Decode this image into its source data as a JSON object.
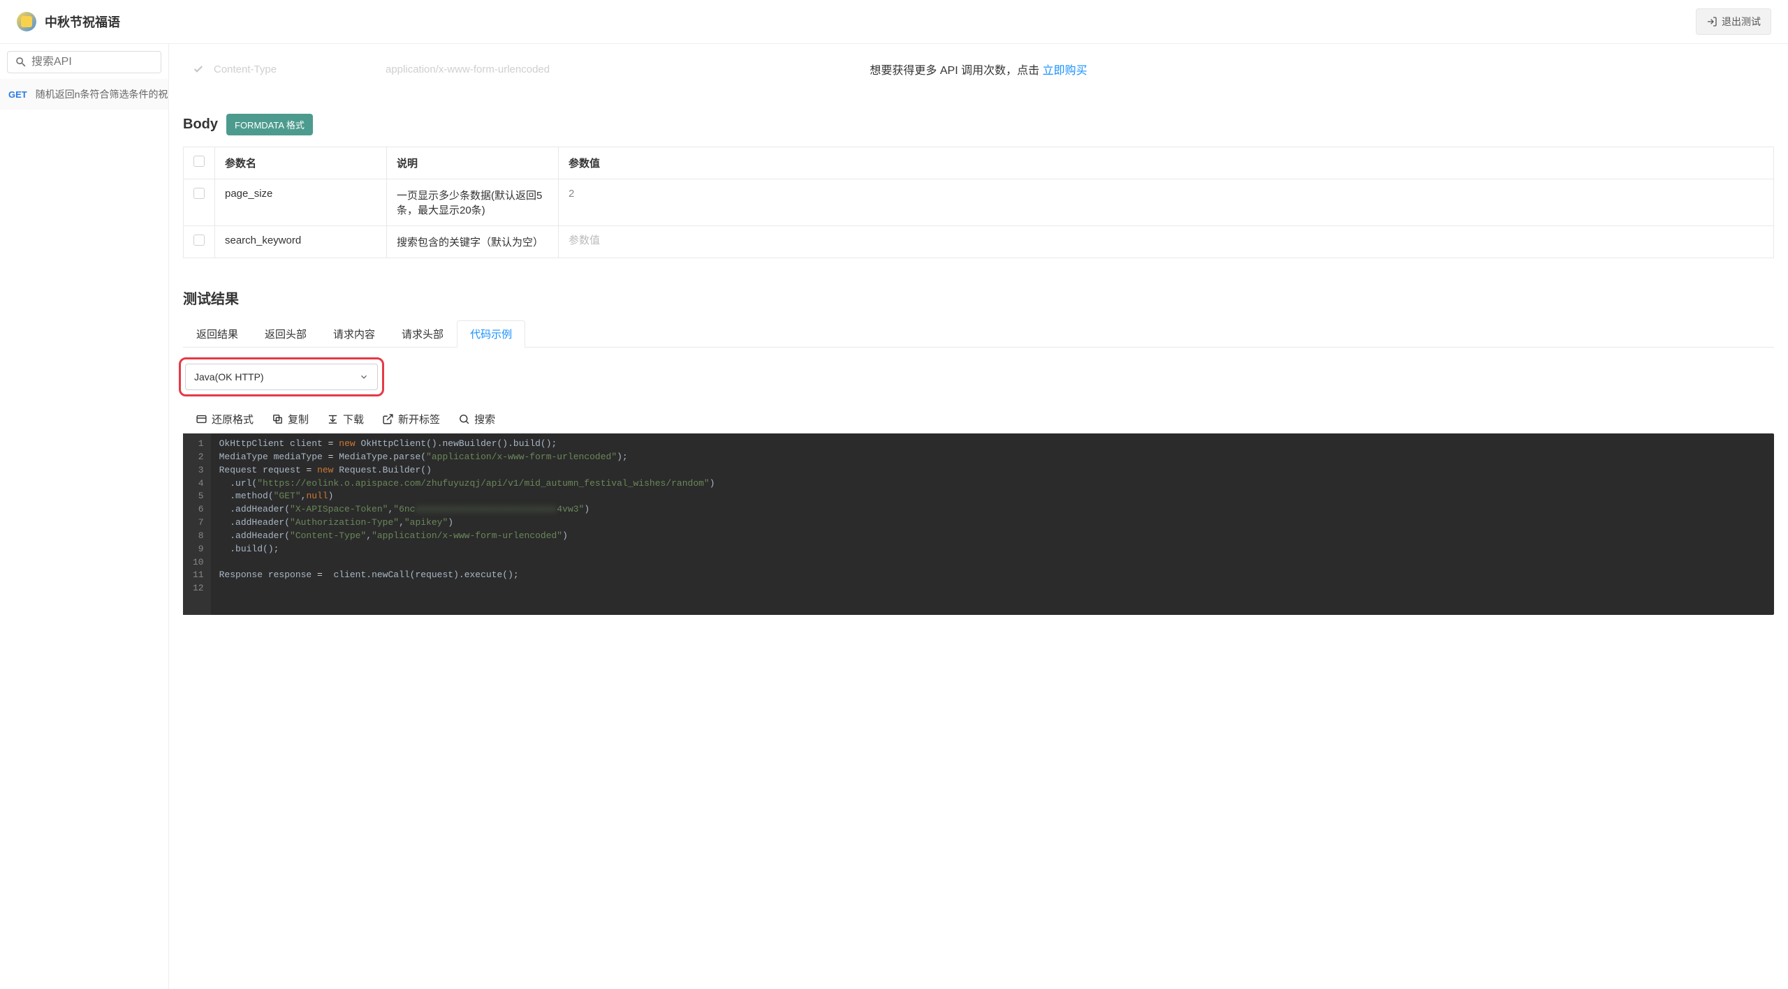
{
  "header": {
    "title": "中秋节祝福语",
    "exit_label": "退出测试"
  },
  "sidebar": {
    "search_placeholder": "搜索API",
    "items": [
      {
        "method": "GET",
        "label": "随机返回n条符合筛选条件的祝福语"
      }
    ]
  },
  "notice": {
    "text_prefix": "想要获得更多 API 调用次数，点击 ",
    "link_text": "立即购买"
  },
  "header_row": {
    "key": "Content-Type",
    "value": "application/x-www-form-urlencoded"
  },
  "body_section": {
    "label": "Body",
    "badge": "FORMDATA 格式",
    "columns": {
      "name": "参数名",
      "desc": "说明",
      "value": "参数值"
    },
    "rows": [
      {
        "name": "page_size",
        "desc": "一页显示多少条数据(默认返回5条，最大显示20条)",
        "value": "2",
        "placeholder": "参数值"
      },
      {
        "name": "search_keyword",
        "desc": "搜索包含的关键字（默认为空）",
        "value": "",
        "placeholder": "参数值"
      }
    ]
  },
  "result": {
    "title": "测试结果",
    "tabs": {
      "response_body": "返回结果",
      "response_headers": "返回头部",
      "request_body": "请求内容",
      "request_headers": "请求头部",
      "code_example": "代码示例"
    },
    "selected_lang": "Java(OK HTTP)",
    "toolbar": {
      "restore": "还原格式",
      "copy": "复制",
      "download": "下载",
      "newtab": "新开标签",
      "search": "搜索"
    },
    "code_url": "https://eolink.o.apispace.com/zhufuyuzqj/api/v1/mid_autumn_festival_wishes/random",
    "code_token_visible_prefix": "6nc",
    "code_token_visible_suffix": "4vw3"
  }
}
